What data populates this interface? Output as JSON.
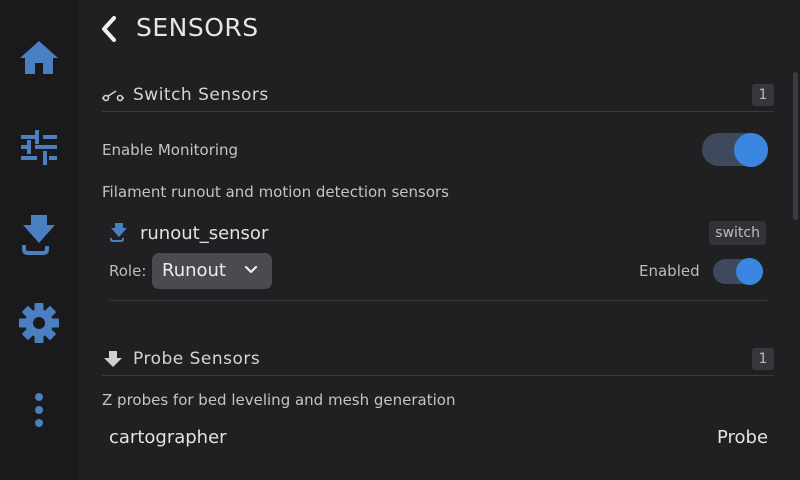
{
  "sidebar": {
    "items": [
      {
        "name": "home-icon"
      },
      {
        "name": "sliders-icon"
      },
      {
        "name": "filament-icon"
      },
      {
        "name": "gear-icon"
      },
      {
        "name": "more-icon"
      }
    ],
    "icon_color": "#4a7fc1"
  },
  "header": {
    "title": "SENSORS"
  },
  "switch_sensors": {
    "title": "Switch Sensors",
    "count": "1",
    "enable_label": "Enable Monitoring",
    "enable_on": true,
    "description": "Filament runout and motion detection sensors",
    "sensor": {
      "name": "runout_sensor",
      "type": "switch",
      "role_label": "Role:",
      "role_value": "Runout",
      "enabled_label": "Enabled",
      "enabled_on": true
    }
  },
  "probe_sensors": {
    "title": "Probe Sensors",
    "count": "1",
    "description": "Z probes for bed leveling and mesh generation",
    "probe": {
      "name": "cartographer",
      "type": "Probe"
    }
  },
  "colors": {
    "accent": "#3a86e0",
    "toggle_track": "#3e4a5c"
  }
}
